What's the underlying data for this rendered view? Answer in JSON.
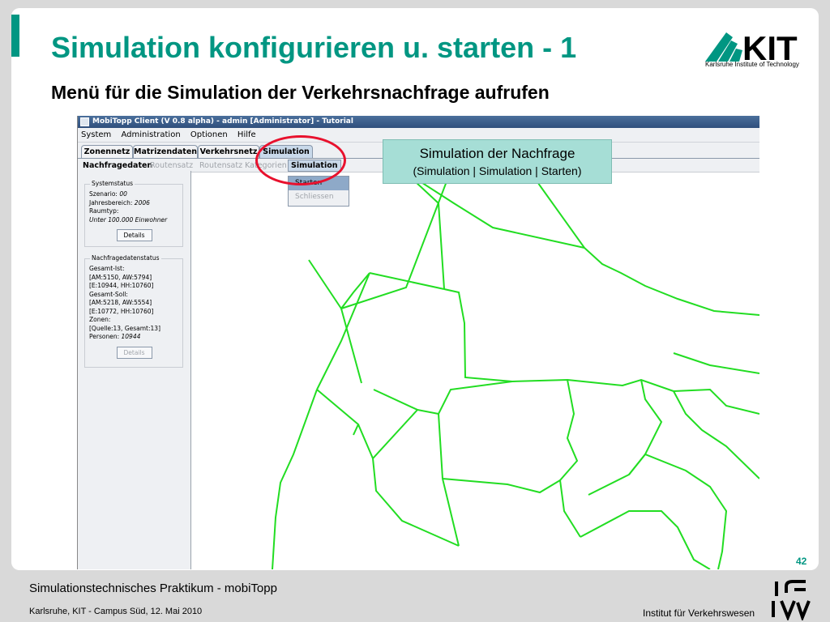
{
  "slide": {
    "title": "Simulation konfigurieren u. starten - 1",
    "subtitle": "Menü für die Simulation der Verkehrsnachfrage aufrufen",
    "logo_text": "KIT",
    "logo_subtitle": "Karlsruhe Institute of Technology",
    "page_number": "42",
    "footer_title": "Simulationstechnisches Praktikum - mobiTopp",
    "footer_info": "Karlsruhe, KIT - Campus Süd, 12. Mai  2010",
    "footer_institute": "Institut für Verkehrswesen"
  },
  "callout": {
    "line1": "Simulation der Nachfrage",
    "line2": "(Simulation | Simulation | Starten)"
  },
  "app": {
    "window_title": "MobiTopp Client (V 0.8 alpha) - admin [Administrator] - Tutorial",
    "menu": [
      "System",
      "Administration",
      "Optionen",
      "Hilfe"
    ],
    "tabs": [
      "Zonennetz",
      "Matrizendaten",
      "Verkehrsnetz",
      "Simulation"
    ],
    "active_tab": "Simulation",
    "subtabs": [
      "Nachfragedaten",
      "Routensatz",
      "Routensatz Kategorien",
      "Simulation"
    ],
    "dropdown": [
      "Starten",
      "Schliessen"
    ],
    "systemstatus": {
      "title": "Systemstatus",
      "szenario_label": "Szenario:",
      "szenario_value": "00",
      "jahr_label": "Jahresbereich:",
      "jahr_value": "2006",
      "raumtyp_label": "Raumtyp:",
      "raumtyp_value": "Unter 100.000 Einwohner",
      "details": "Details"
    },
    "nachfragestatus": {
      "title": "Nachfragedatenstatus",
      "lines": [
        "Gesamt-Ist:",
        "[AM:5150, AW:5794]",
        "[E:10944, HH:10760]",
        "Gesamt-Soll:",
        "[AM:5218, AW:5554]",
        "[E:10772, HH:10760]",
        "Zonen:",
        "[Quelle:13, Gesamt:13]"
      ],
      "personen_label": "Personen:",
      "personen_value": "10944",
      "details": "Details"
    },
    "colors": {
      "zone_line": "#22dd22",
      "highlight_circle": "#e8112d",
      "callout_bg": "#a6ded6",
      "accent": "#009682"
    }
  }
}
